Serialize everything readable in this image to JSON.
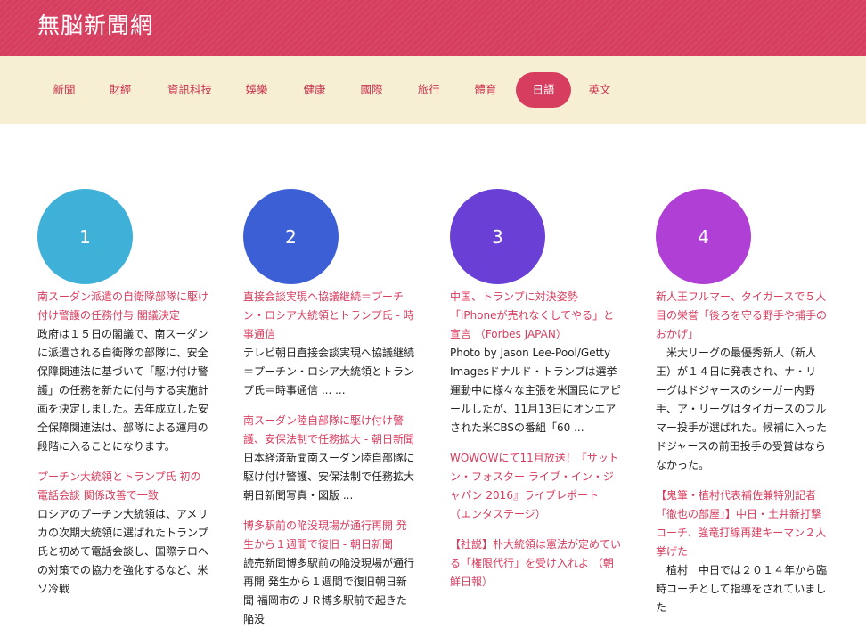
{
  "site": {
    "title": "無脳新聞網"
  },
  "colors": {
    "header": "#d63d5e",
    "nav_bg": "#f7efd3",
    "accent": "#d63d5e"
  },
  "nav": [
    {
      "label": "新聞"
    },
    {
      "label": "財經"
    },
    {
      "label": "資訊科技"
    },
    {
      "label": "娛樂"
    },
    {
      "label": "健康"
    },
    {
      "label": "國際"
    },
    {
      "label": "旅行"
    },
    {
      "label": "體育"
    },
    {
      "label": "日語",
      "active": true
    },
    {
      "label": "英文"
    }
  ],
  "columns": [
    {
      "number": "1",
      "color": "#3fb1d9",
      "articles": [
        {
          "title": "南スーダン派遣の自衛隊部隊に駆け付け警護の任務付与 閣議決定",
          "body": "政府は１５日の閣議で、南スーダンに派遣される自衛隊の部隊に、安全保障関連法に基づいて「駆け付け警護」の任務を新たに付与する実施計画を決定しました。去年成立した安全保障関連法は、部隊による運用の段階に入ることになります。"
        },
        {
          "title": "プーチン大統領とトランプ氏 初の電話会談 関係改善で一致",
          "body": "ロシアのプーチン大統領は、アメリカの次期大統領に選ばれたトランプ氏と初めて電話会談し、国際テロへの対策での協力を強化するなど、米ソ冷戦"
        }
      ]
    },
    {
      "number": "2",
      "color": "#3d5fd6",
      "articles": [
        {
          "title": "直接会談実現へ協議継続＝プーチン・ロシア大統領とトランプ氏 - 時事通信",
          "body": "テレビ朝日直接会談実現へ協議継続＝プーチン・ロシア大統領とトランプ氏＝時事通信 ... ..."
        },
        {
          "title": "南スーダン陸自部隊に駆け付け警護、安保法制で任務拡大 - 朝日新聞",
          "body": "日本経済新聞南スーダン陸自部隊に駆け付け警護、安保法制で任務拡大朝日新聞写真・図版 ..."
        },
        {
          "title": "博多駅前の陥没現場が通行再開 発生から１週間で復旧 - 朝日新聞",
          "body": "読売新聞博多駅前の陥没現場が通行再開 発生から１週間で復旧朝日新聞 福岡市のＪＲ博多駅前で起きた陥没"
        }
      ]
    },
    {
      "number": "3",
      "color": "#6a3fd6",
      "articles": [
        {
          "title": "中国、トランプに対決姿勢「iPhoneが売れなくしてやる」と宣言 （Forbes JAPAN）",
          "body": "Photo by Jason Lee-Pool/Getty Imagesドナルド・トランプは選挙運動中に様々な主張を米国民にアピールしたが、11月13日にオンエアされた米CBSの番組「60 ..."
        },
        {
          "title": "WOWOWにて11月放送！『サットン・フォスター ライブ・イン・ジャパン 2016』ライブレポート （エンタステージ）",
          "body": ""
        },
        {
          "title": "【社説】朴大統領は憲法が定めている「権限代行」を受け入れよ （朝鮮日報）",
          "body": ""
        }
      ]
    },
    {
      "number": "4",
      "color": "#b03fd6",
      "articles": [
        {
          "title": "新人王フルマー、タイガースで５人目の栄誉「後ろを守る野手や捕手のおかげ」",
          "body": "　米大リーグの最優秀新人（新人王）が１４日に発表され、ナ・リーグはドジャースのシーガー内野手、ア・リーグはタイガースのフルマー投手が選ばれた。候補に入ったドジャースの前田投手の受賞はならなかった。"
        },
        {
          "title": "【鬼筆・植村代表補佐兼特別記者「徹也の部屋」】中日・土井新打撃コーチ、強竜打線再建キーマン２人挙げた",
          "body": "　植村　中日では２０１４年から臨時コーチとして指導をされていました"
        }
      ]
    }
  ]
}
